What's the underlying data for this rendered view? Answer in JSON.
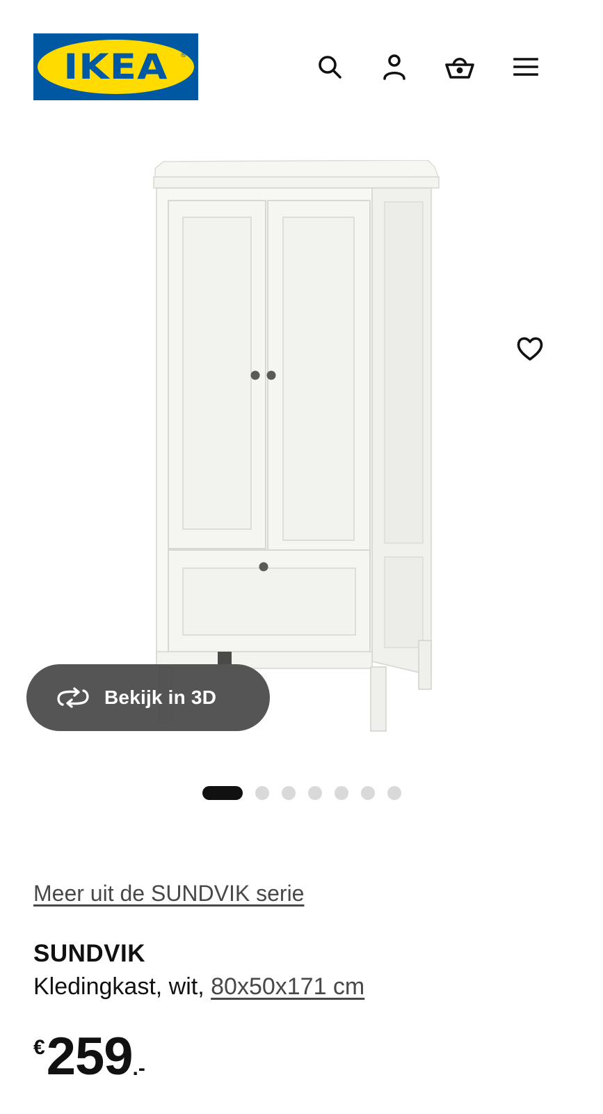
{
  "header": {
    "logo_text": "IKEA",
    "logo_reg": "®",
    "icons": [
      "search-icon",
      "account-icon",
      "basket-icon",
      "menu-icon"
    ]
  },
  "gallery": {
    "image_alt": "SUNDVIK Kledingkast, wit",
    "view_3d_label": "Bekijk in 3D",
    "slide_count": 7,
    "active_slide": 1
  },
  "product": {
    "series_link": "Meer uit de SUNDVIK serie",
    "name": "SUNDVIK",
    "description": "Kledingkast, wit, ",
    "dimensions": "80x50x171 cm",
    "price_currency": "€",
    "price_amount": "259",
    "price_decimal": ".-"
  },
  "colors": {
    "brand_blue": "#0058a3",
    "brand_yellow": "#ffdb00",
    "text": "#111111",
    "button_3d_bg": "#484848"
  }
}
